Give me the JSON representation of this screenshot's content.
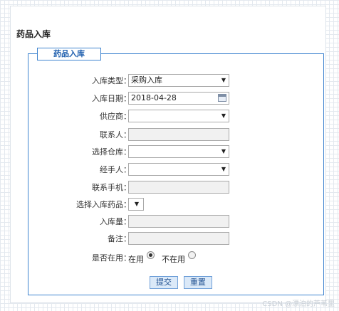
{
  "page": {
    "title": "药品入库"
  },
  "form": {
    "legend": "药品入库",
    "type_label": "入库类型：",
    "type_value": "采购入库",
    "date_label": "入库日期：",
    "date_value": "2018-04-28",
    "supplier_label": "供应商：",
    "contact_label": "联系人：",
    "warehouse_label": "选择仓库：",
    "handler_label": "经手人：",
    "phone_label": "联系手机：",
    "drug_label": "选择入库药品：",
    "quantity_label": "入库量：",
    "remark_label": "备注：",
    "enabled_label": "是否在用：",
    "enabled_yes": "在用",
    "enabled_no": "不在用",
    "submit_label": "提交",
    "reset_label": "重置"
  },
  "watermark": "CSDN @漂泊的芦苇里"
}
